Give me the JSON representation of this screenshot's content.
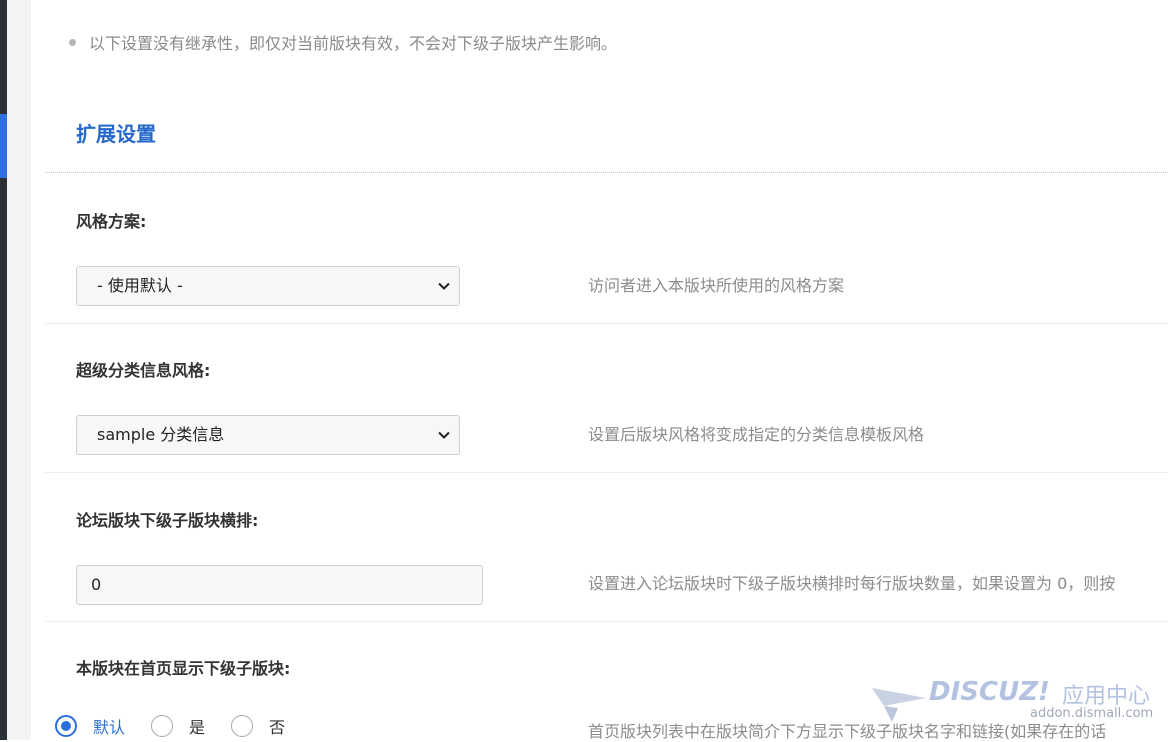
{
  "tip_text": "以下设置没有继承性，即仅对当前版块有效，不会对下级子版块产生影响。",
  "section_title": "扩展设置",
  "fields": [
    {
      "label": "风格方案:",
      "type": "select",
      "value": "- 使用默认 -",
      "description": "访问者进入本版块所使用的风格方案"
    },
    {
      "label": "超级分类信息风格:",
      "type": "select",
      "value": "sample 分类信息",
      "description": "设置后版块风格将变成指定的分类信息模板风格"
    },
    {
      "label": "论坛版块下级子版块横排:",
      "type": "text",
      "value": "0",
      "description": "设置进入论坛版块时下级子版块横排时每行版块数量，如果设置为 0，则按"
    },
    {
      "label": "本版块在首页显示下级子版块:",
      "type": "radio",
      "options": [
        "默认",
        "是",
        "否"
      ],
      "selected": "默认",
      "description": "首页版块列表中在版块简介下方显示下级子版块名字和链接(如果存在的话"
    }
  ],
  "watermark": {
    "brand": "DISCUZ!",
    "label": "应用中心",
    "url": "addon.dismall.com"
  },
  "colors": {
    "accent": "#2668c9",
    "radio_active": "#2b6fd9",
    "rail": "#2b2f36"
  }
}
